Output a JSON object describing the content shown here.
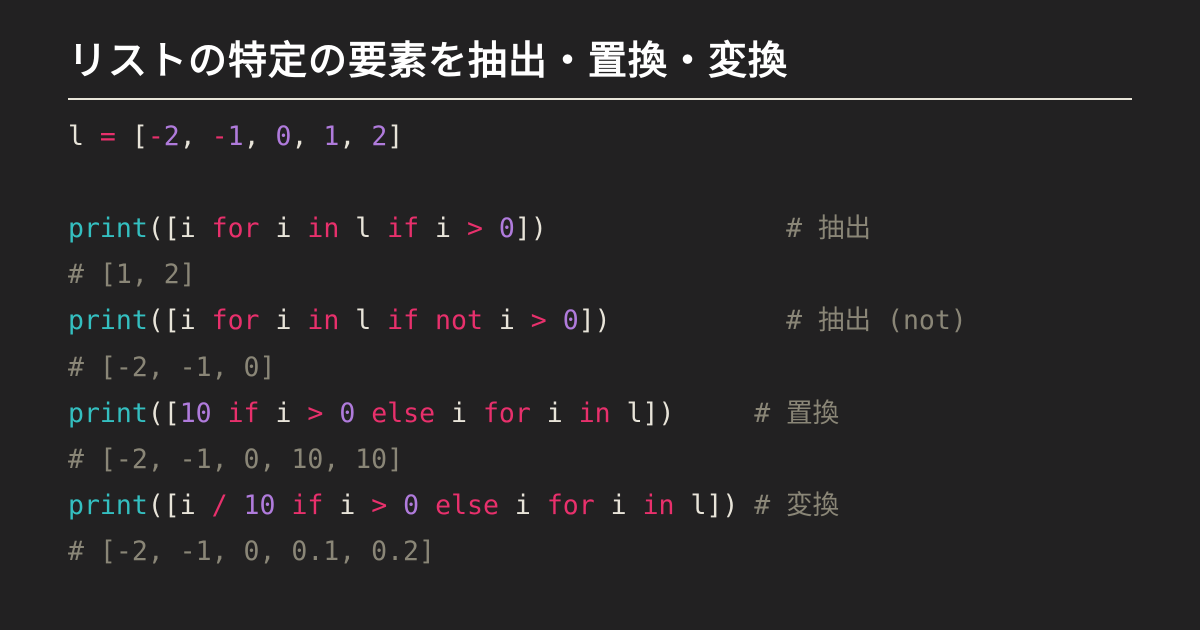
{
  "title": "リストの特定の要素を抽出・置換・変換",
  "code": {
    "lines": [
      {
        "type": "code",
        "tokens": [
          {
            "c": "plain",
            "t": "l "
          },
          {
            "c": "op",
            "t": "="
          },
          {
            "c": "plain",
            "t": " ["
          },
          {
            "c": "op",
            "t": "-"
          },
          {
            "c": "num",
            "t": "2"
          },
          {
            "c": "plain",
            "t": ", "
          },
          {
            "c": "op",
            "t": "-"
          },
          {
            "c": "num",
            "t": "1"
          },
          {
            "c": "plain",
            "t": ", "
          },
          {
            "c": "num",
            "t": "0"
          },
          {
            "c": "plain",
            "t": ", "
          },
          {
            "c": "num",
            "t": "1"
          },
          {
            "c": "plain",
            "t": ", "
          },
          {
            "c": "num",
            "t": "2"
          },
          {
            "c": "plain",
            "t": "]"
          }
        ]
      },
      {
        "type": "blank"
      },
      {
        "type": "code",
        "tokens": [
          {
            "c": "fn",
            "t": "print"
          },
          {
            "c": "plain",
            "t": "([i "
          },
          {
            "c": "kw",
            "t": "for"
          },
          {
            "c": "plain",
            "t": " i "
          },
          {
            "c": "kw",
            "t": "in"
          },
          {
            "c": "plain",
            "t": " l "
          },
          {
            "c": "kw",
            "t": "if"
          },
          {
            "c": "plain",
            "t": " i "
          },
          {
            "c": "op",
            "t": ">"
          },
          {
            "c": "plain",
            "t": " "
          },
          {
            "c": "num",
            "t": "0"
          },
          {
            "c": "plain",
            "t": "])               "
          },
          {
            "c": "cmt",
            "t": "# 抽出"
          }
        ]
      },
      {
        "type": "code",
        "tokens": [
          {
            "c": "cmt",
            "t": "# [1, 2]"
          }
        ]
      },
      {
        "type": "code",
        "tokens": [
          {
            "c": "fn",
            "t": "print"
          },
          {
            "c": "plain",
            "t": "([i "
          },
          {
            "c": "kw",
            "t": "for"
          },
          {
            "c": "plain",
            "t": " i "
          },
          {
            "c": "kw",
            "t": "in"
          },
          {
            "c": "plain",
            "t": " l "
          },
          {
            "c": "kw",
            "t": "if"
          },
          {
            "c": "plain",
            "t": " "
          },
          {
            "c": "kw",
            "t": "not"
          },
          {
            "c": "plain",
            "t": " i "
          },
          {
            "c": "op",
            "t": ">"
          },
          {
            "c": "plain",
            "t": " "
          },
          {
            "c": "num",
            "t": "0"
          },
          {
            "c": "plain",
            "t": "])           "
          },
          {
            "c": "cmt",
            "t": "# 抽出 (not)"
          }
        ]
      },
      {
        "type": "code",
        "tokens": [
          {
            "c": "cmt",
            "t": "# [-2, -1, 0]"
          }
        ]
      },
      {
        "type": "code",
        "tokens": [
          {
            "c": "fn",
            "t": "print"
          },
          {
            "c": "plain",
            "t": "(["
          },
          {
            "c": "num",
            "t": "10"
          },
          {
            "c": "plain",
            "t": " "
          },
          {
            "c": "kw",
            "t": "if"
          },
          {
            "c": "plain",
            "t": " i "
          },
          {
            "c": "op",
            "t": ">"
          },
          {
            "c": "plain",
            "t": " "
          },
          {
            "c": "num",
            "t": "0"
          },
          {
            "c": "plain",
            "t": " "
          },
          {
            "c": "kw",
            "t": "else"
          },
          {
            "c": "plain",
            "t": " i "
          },
          {
            "c": "kw",
            "t": "for"
          },
          {
            "c": "plain",
            "t": " i "
          },
          {
            "c": "kw",
            "t": "in"
          },
          {
            "c": "plain",
            "t": " l])     "
          },
          {
            "c": "cmt",
            "t": "# 置換"
          }
        ]
      },
      {
        "type": "code",
        "tokens": [
          {
            "c": "cmt",
            "t": "# [-2, -1, 0, 10, 10]"
          }
        ]
      },
      {
        "type": "code",
        "tokens": [
          {
            "c": "fn",
            "t": "print"
          },
          {
            "c": "plain",
            "t": "([i "
          },
          {
            "c": "op",
            "t": "/"
          },
          {
            "c": "plain",
            "t": " "
          },
          {
            "c": "num",
            "t": "10"
          },
          {
            "c": "plain",
            "t": " "
          },
          {
            "c": "kw",
            "t": "if"
          },
          {
            "c": "plain",
            "t": " i "
          },
          {
            "c": "op",
            "t": ">"
          },
          {
            "c": "plain",
            "t": " "
          },
          {
            "c": "num",
            "t": "0"
          },
          {
            "c": "plain",
            "t": " "
          },
          {
            "c": "kw",
            "t": "else"
          },
          {
            "c": "plain",
            "t": " i "
          },
          {
            "c": "kw",
            "t": "for"
          },
          {
            "c": "plain",
            "t": " i "
          },
          {
            "c": "kw",
            "t": "in"
          },
          {
            "c": "plain",
            "t": " l]) "
          },
          {
            "c": "cmt",
            "t": "# 変換"
          }
        ]
      },
      {
        "type": "code",
        "tokens": [
          {
            "c": "cmt",
            "t": "# [-2, -1, 0, 0.1, 0.2]"
          }
        ]
      }
    ]
  }
}
